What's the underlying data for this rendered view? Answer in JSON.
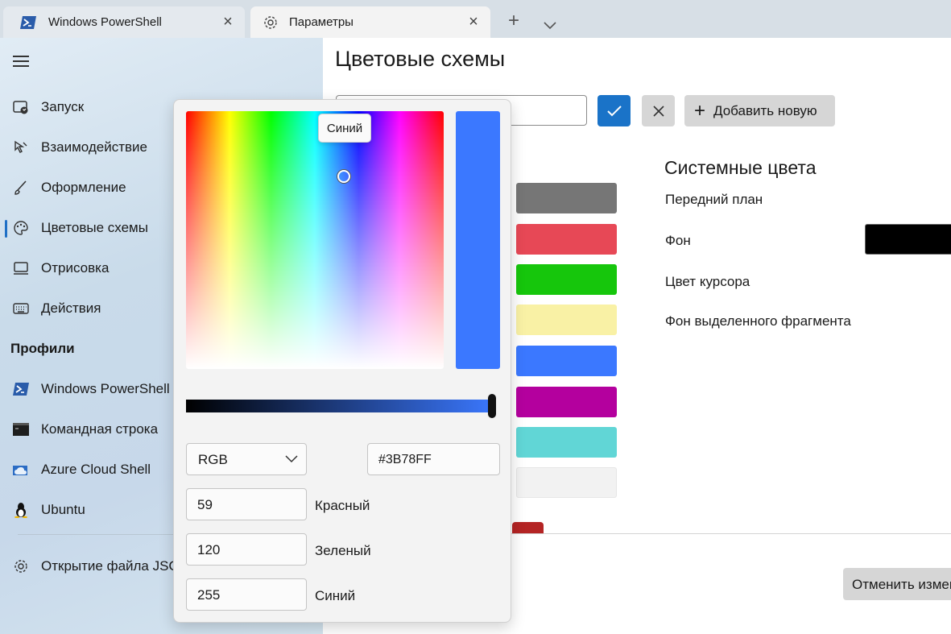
{
  "tabs": [
    {
      "label": "Windows PowerShell",
      "icon": "powershell-icon",
      "active": false
    },
    {
      "label": "Параметры",
      "icon": "gear-icon",
      "active": true
    }
  ],
  "tabbar_controls": {
    "new_tab": "+",
    "dropdown": "chevron-down-icon"
  },
  "sidebar": {
    "items": [
      {
        "label": "Запуск",
        "icon": "startup-icon"
      },
      {
        "label": "Взаимодействие",
        "icon": "cursor-icon"
      },
      {
        "label": "Оформление",
        "icon": "brush-icon"
      },
      {
        "label": "Цветовые схемы",
        "icon": "palette-icon",
        "selected": true
      },
      {
        "label": "Отрисовка",
        "icon": "monitor-icon"
      },
      {
        "label": "Действия",
        "icon": "keyboard-icon"
      }
    ],
    "profiles_title": "Профили",
    "profiles": [
      {
        "label": "Windows PowerShell",
        "icon": "powershell-icon"
      },
      {
        "label": "Командная строка",
        "icon": "cmd-icon"
      },
      {
        "label": "Azure Cloud Shell",
        "icon": "azure-icon"
      },
      {
        "label": "Ubuntu",
        "icon": "linux-icon"
      }
    ],
    "footer_item": {
      "label": "Открытие файла JSON",
      "icon": "gear-icon"
    }
  },
  "main": {
    "title": "Цветовые схемы",
    "name_input_value": "",
    "add_new_label": "Добавить новую",
    "swatches": [
      "#767676",
      "#e74856",
      "#16c60c",
      "#f9f1a5",
      "#3b78ff",
      "#b4009e",
      "#61d6d6",
      "#f2f2f2"
    ],
    "system_colors_title": "Системные цвета",
    "system_colors": [
      {
        "label": "Передний план"
      },
      {
        "label": "Фон",
        "color": "#000000"
      },
      {
        "label": "Цвет курсора"
      },
      {
        "label": "Фон выделенного фрагмента"
      }
    ],
    "cancel_changes_label": "Отменить изменения"
  },
  "color_picker": {
    "tooltip": "Синий",
    "selected_color": "#3B78FF",
    "color_model": "RGB",
    "hex_value": "#3B78FF",
    "hue_deg": 221,
    "saturation": 0.77,
    "brightness": 1.0,
    "channels": [
      {
        "label": "Красный",
        "value": "59"
      },
      {
        "label": "Зеленый",
        "value": "120"
      },
      {
        "label": "Синий",
        "value": "255"
      }
    ]
  }
}
